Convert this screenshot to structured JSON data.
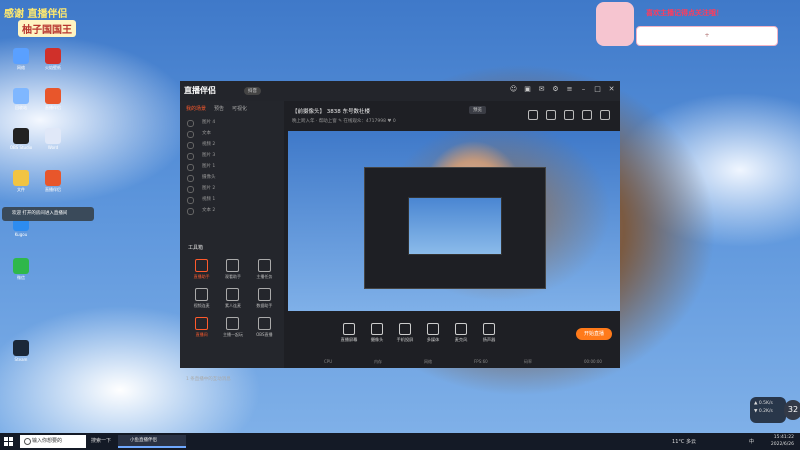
{
  "overlay": {
    "left_banner_line1": "感谢 直播伴侣",
    "left_banner_line2": "柚子国国王",
    "right_follow": "喜欢主播记得点关注哦！",
    "right_bar": "+"
  },
  "desktop_icons": [
    {
      "label": "网络",
      "color": "#5aa0ff"
    },
    {
      "label": "火焰壁纸",
      "color": "#d0302a"
    },
    {
      "label": "回收站",
      "color": "#7fb7ff"
    },
    {
      "label": "直播伴侣",
      "color": "#e8562b"
    },
    {
      "label": "OBS Studio",
      "color": "#222"
    },
    {
      "label": "Word",
      "color": "#e0e8f8"
    },
    {
      "label": "文件",
      "color": "#f2c443"
    },
    {
      "label": "直播伴侣",
      "color": "#e8562b"
    },
    {
      "label": "Kugou",
      "color": "#2d8cf0"
    },
    {
      "label": "微信",
      "color": "#2fb84a"
    },
    {
      "label": "Steam",
      "color": "#1b2838"
    }
  ],
  "desktop_notice": "欢迎 打开的房间进入直播间",
  "app": {
    "logo": "直播伴侣",
    "logo_badge": "抖音",
    "left_tabs": [
      "我的场景",
      "预告",
      "可视化"
    ],
    "scenes": [
      "图片 4",
      "文本",
      "视频 2",
      "图片 3",
      "图片 1",
      "摄像头",
      "图片 2",
      "视频 1",
      "文本 2"
    ],
    "tools_title": "工具箱",
    "tools": [
      {
        "label": "直播助手",
        "hot": true
      },
      {
        "label": "观看助手",
        "hot": false
      },
      {
        "label": "主播任务",
        "hot": false
      },
      {
        "label": "视频连麦",
        "hot": false
      },
      {
        "label": "素人连麦",
        "hot": false
      },
      {
        "label": "数据助手",
        "hot": false
      },
      {
        "label": "直播间",
        "hot": true
      },
      {
        "label": "主播一起玩",
        "hot": false
      },
      {
        "label": "OBS直播",
        "hot": false
      }
    ],
    "left_footer": "1 条直播中的互动消息",
    "room_title": "【前摄像头】 3838 东号数社楼",
    "room_tag": "预览",
    "room_sub": "晚上跨入年 · 帮助上窗 ✎   在线观众：4717998   ♥ 0",
    "controls": [
      "直播屏幕",
      "摄像头",
      "手机投屏",
      "多媒体",
      "麦克风",
      "扬声器"
    ],
    "go_live": "开始直播",
    "status": [
      "CPU",
      "内存",
      "网络",
      "FPS:60",
      "码率",
      "00:00:00"
    ]
  },
  "taskbar": {
    "search_placeholder": "输入你想要的",
    "button_text": "搜索一下",
    "app_label": "小鱼直播伴侣",
    "weather": "11°C  多云",
    "ime": "中",
    "time": "15:41:22",
    "date": "2022/6/26"
  },
  "netwidget": {
    "up": "▲ 0.5K/s",
    "down": "▼ 0.2K/s",
    "ball": "32"
  }
}
